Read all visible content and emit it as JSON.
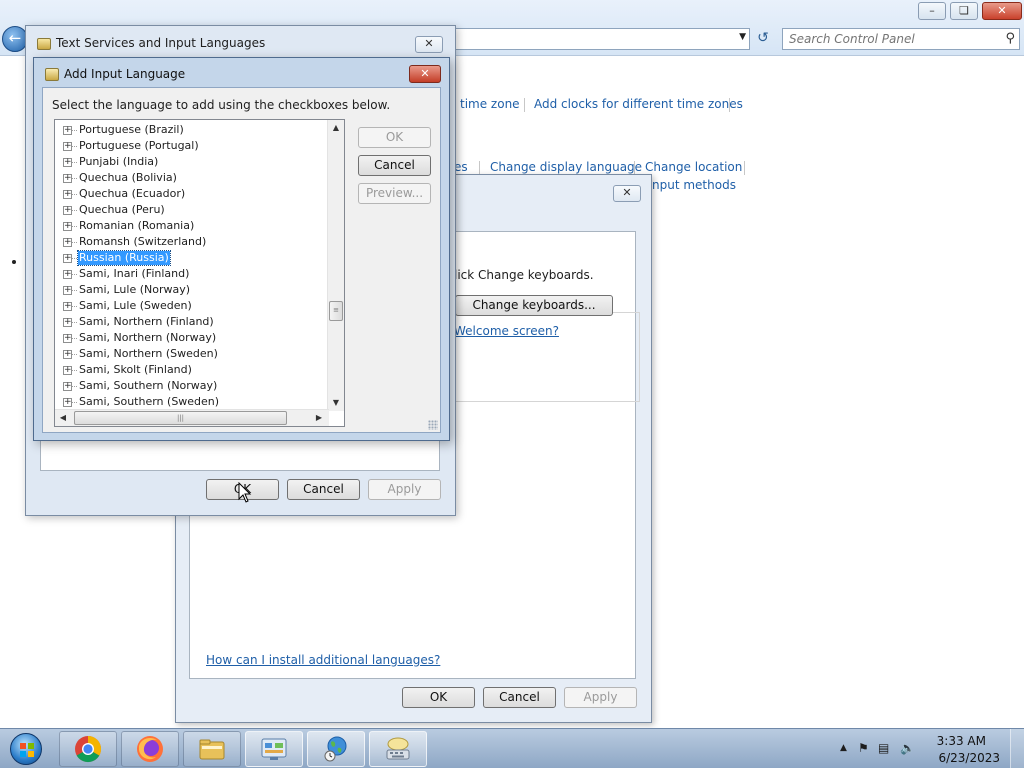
{
  "control_panel": {
    "search_placeholder": "Search Control Panel",
    "links": {
      "time_zone": "time zone",
      "add_clocks": "Add clocks for different time zones",
      "languages": "es",
      "change_display_language": "Change display language",
      "change_location": "Change location",
      "input_methods": "nput methods"
    }
  },
  "region_dialog": {
    "keyboards_text": "lick Change keyboards.",
    "change_keyboards_button": "Change keyboards...",
    "welcome_link": "Welcome screen?",
    "install_link": "How can I install additional languages?",
    "ok_button": "OK",
    "cancel_button": "Cancel",
    "apply_button": "Apply"
  },
  "text_services_dialog": {
    "title": "Text Services and Input Languages",
    "ok_button": "OK",
    "cancel_button": "Cancel",
    "apply_button": "Apply"
  },
  "add_input_language": {
    "title": "Add Input Language",
    "instruction": "Select the language to add using the checkboxes below.",
    "ok_button": "OK",
    "cancel_button": "Cancel",
    "preview_button": "Preview...",
    "languages": [
      {
        "label": "Portuguese (Brazil)",
        "selected": false
      },
      {
        "label": "Portuguese (Portugal)",
        "selected": false
      },
      {
        "label": "Punjabi (India)",
        "selected": false
      },
      {
        "label": "Quechua (Bolivia)",
        "selected": false
      },
      {
        "label": "Quechua (Ecuador)",
        "selected": false
      },
      {
        "label": "Quechua (Peru)",
        "selected": false
      },
      {
        "label": "Romanian (Romania)",
        "selected": false
      },
      {
        "label": "Romansh (Switzerland)",
        "selected": false
      },
      {
        "label": "Russian (Russia)",
        "selected": true
      },
      {
        "label": "Sami, Inari (Finland)",
        "selected": false
      },
      {
        "label": "Sami, Lule (Norway)",
        "selected": false
      },
      {
        "label": "Sami, Lule (Sweden)",
        "selected": false
      },
      {
        "label": "Sami, Northern (Finland)",
        "selected": false
      },
      {
        "label": "Sami, Northern (Norway)",
        "selected": false
      },
      {
        "label": "Sami, Northern (Sweden)",
        "selected": false
      },
      {
        "label": "Sami, Skolt (Finland)",
        "selected": false
      },
      {
        "label": "Sami, Southern (Norway)",
        "selected": false
      },
      {
        "label": "Sami, Southern (Sweden)",
        "selected": false
      }
    ]
  },
  "taskbar": {
    "apps": [
      "chrome-icon",
      "firefox-icon",
      "file-explorer-icon",
      "control-panel-icon",
      "region-globe-icon",
      "keyboard-icon"
    ],
    "clock_time": "3:33 AM",
    "clock_date": "6/23/2023"
  }
}
